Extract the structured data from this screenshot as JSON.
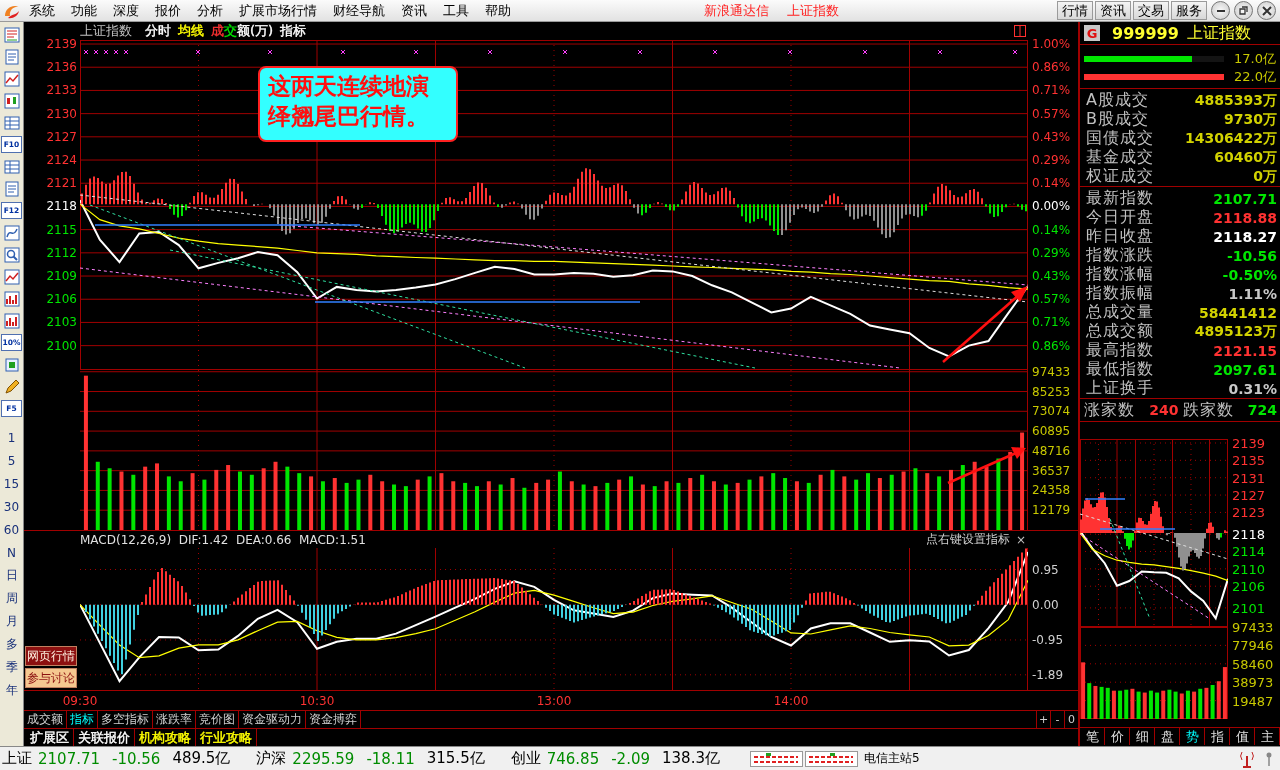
{
  "menu": {
    "items": [
      "系统",
      "功能",
      "深度",
      "报价",
      "分析",
      "扩展市场行情",
      "财经导航",
      "资讯",
      "工具",
      "帮助"
    ],
    "titles": [
      "新浪通达信",
      "上证指数"
    ],
    "buttons": [
      "行情",
      "资讯",
      "交易",
      "服务"
    ]
  },
  "toolbar": [
    {
      "kind": "icon"
    },
    {
      "kind": "icon"
    },
    {
      "kind": "icon"
    },
    {
      "kind": "icon"
    },
    {
      "kind": "icon"
    },
    {
      "kind": "text",
      "label": "F10"
    },
    {
      "kind": "icon"
    },
    {
      "kind": "icon"
    },
    {
      "kind": "text",
      "label": "F12"
    },
    {
      "kind": "icon"
    },
    {
      "kind": "icon"
    },
    {
      "kind": "icon"
    },
    {
      "kind": "icon"
    },
    {
      "kind": "icon"
    },
    {
      "kind": "text",
      "label": "10%"
    },
    {
      "kind": "icon"
    },
    {
      "kind": "icon"
    },
    {
      "kind": "text",
      "label": "F5"
    }
  ],
  "periods": [
    "1",
    "5",
    "15",
    "30",
    "60",
    "N",
    "日",
    "周",
    "月",
    "多",
    "季",
    "年"
  ],
  "side_links": [
    {
      "label": "网页行情",
      "color": "#8c1010"
    },
    {
      "label": "参与讨论",
      "color": "#f5c890"
    }
  ],
  "chart_header": {
    "title": "上证指数",
    "items": [
      {
        "segments": [
          {
            "text": "分时",
            "color": "#ffffff"
          }
        ]
      },
      {
        "segments": [
          {
            "text": "均线",
            "color": "#ffff00"
          }
        ]
      },
      {
        "segments": [
          {
            "text": "成",
            "color": "#ff3232"
          },
          {
            "text": "交",
            "color": "#00e600"
          },
          {
            "text": "额(万)",
            "color": "#ffffff"
          }
        ]
      },
      {
        "segments": [
          {
            "text": "指标",
            "color": "#ffffff"
          }
        ]
      }
    ]
  },
  "callout": "这两天连续地演绎翘尾巴行情。",
  "price_chart": {
    "right_ticks": [
      "1.00%",
      "0.86%",
      "0.71%",
      "0.57%",
      "0.43%",
      "0.29%",
      "0.14%",
      "0.00%",
      "0.14%",
      "0.29%",
      "0.43%",
      "0.57%",
      "0.71%",
      "0.86%"
    ],
    "chart_data": {
      "type": "line",
      "grid": true,
      "ylim": [
        2096.85,
        2139.52
      ],
      "categories": [
        null,
        null,
        null,
        null,
        null,
        null,
        null,
        null,
        null,
        null,
        null,
        null,
        null,
        null,
        null,
        null,
        null,
        null,
        null,
        null,
        null,
        null,
        null,
        null,
        null,
        null,
        null,
        null,
        null,
        null,
        null,
        null,
        null,
        null,
        null,
        null,
        null,
        null,
        null,
        null,
        null,
        null,
        null,
        null,
        null,
        null,
        null,
        null,
        null
      ],
      "series": [
        {
          "color": "#ffffff",
          "values": [
            2118.8,
            2113.7,
            2110.8,
            2114.5,
            2114.7,
            2113.0,
            2110.0,
            2110.7,
            2111.3,
            2112.1,
            2111.7,
            2109.5,
            2106.1,
            2107.6,
            2107.2,
            2107.0,
            2107.2,
            2107.5,
            2107.9,
            2108.6,
            2109.4,
            2110.2,
            2109.9,
            2109.2,
            2109.2,
            2109.4,
            2109.3,
            2108.9,
            2109.1,
            2109.7,
            2109.6,
            2109.0,
            2107.8,
            2106.9,
            2105.6,
            2104.3,
            2104.8,
            2106.3,
            2105.2,
            2104.1,
            2102.6,
            2102.1,
            2101.6,
            2099.7,
            2098.6,
            2100.0,
            2100.6,
            2104.2,
            2107.7
          ]
        },
        {
          "color": "#ffff00",
          "values": [
            2118.3,
            2116.3,
            2115.5,
            2115.1,
            2114.5,
            2113.9,
            2113.5,
            2113.2,
            2113.0,
            2112.8,
            2112.6,
            2112.3,
            2112.0,
            2111.9,
            2111.8,
            2111.6,
            2111.5,
            2111.4,
            2111.3,
            2111.2,
            2111.1,
            2111.0,
            2111.0,
            2110.9,
            2110.9,
            2110.8,
            2110.7,
            2110.6,
            2110.5,
            2110.4,
            2110.3,
            2110.2,
            2110.1,
            2110.0,
            2109.9,
            2109.8,
            2109.6,
            2109.5,
            2109.3,
            2109.2,
            2109.0,
            2108.8,
            2108.6,
            2108.4,
            2108.3,
            2108.0,
            2107.8,
            2107.5,
            2107.3
          ]
        }
      ],
      "yticks": [
        {
          "value": 2139,
          "label": "2139"
        },
        {
          "value": 2136,
          "label": "2136"
        },
        {
          "value": 2133,
          "label": "2133"
        },
        {
          "value": 2130,
          "label": "2130"
        },
        {
          "value": 2127,
          "label": "2127"
        },
        {
          "value": 2124,
          "label": "2124"
        },
        {
          "value": 2121,
          "label": "2121"
        },
        {
          "value": 2118,
          "label": "2118"
        },
        {
          "value": 2115,
          "label": "2115"
        },
        {
          "value": 2112,
          "label": "2112"
        },
        {
          "value": 2109,
          "label": "2109"
        },
        {
          "value": 2106,
          "label": "2106"
        },
        {
          "value": 2103,
          "label": "2103"
        },
        {
          "value": 2100,
          "label": "2100"
        }
      ]
    }
  },
  "volume_chart": {
    "chart_data": {
      "type": "bar",
      "stacked": true,
      "grid": true,
      "ylim": [
        0,
        98500
      ],
      "series": [
        {
          "color": "#ff3232",
          "values": [
            95000,
            null,
            null,
            36000,
            null,
            39000,
            41000,
            null,
            null,
            35000,
            null,
            37000,
            40000,
            null,
            null,
            38000,
            42000,
            null,
            null,
            33000,
            null,
            32000,
            null,
            null,
            34000,
            30000,
            null,
            null,
            31000,
            null,
            35000,
            30000,
            null,
            null,
            30000,
            null,
            32000,
            null,
            29000,
            31000,
            null,
            30000,
            null,
            27000,
            null,
            31000,
            null,
            28000,
            null,
            30000,
            null,
            32000,
            null,
            30000,
            null,
            29000,
            null,
            33000,
            null,
            null,
            30000,
            null,
            34000,
            null,
            33000,
            null,
            null,
            32000,
            null,
            36000,
            null,
            35000,
            null,
            37000,
            null,
            42000,
            39000,
            null,
            48000,
            60000
          ]
        },
        {
          "color": "#00e600",
          "values": [
            null,
            42000,
            38000,
            null,
            34000,
            null,
            null,
            33000,
            30000,
            null,
            31000,
            null,
            null,
            36000,
            34000,
            null,
            null,
            39000,
            35000,
            null,
            30000,
            null,
            29000,
            31000,
            null,
            null,
            28000,
            27000,
            null,
            33000,
            null,
            null,
            29000,
            27000,
            null,
            28000,
            null,
            26000,
            null,
            null,
            36000,
            null,
            28000,
            null,
            29000,
            null,
            33000,
            null,
            27000,
            null,
            29000,
            null,
            34000,
            null,
            28000,
            null,
            31000,
            null,
            35000,
            32000,
            null,
            29000,
            null,
            37000,
            null,
            31000,
            35000,
            null,
            34000,
            null,
            38000,
            null,
            33000,
            null,
            40000,
            null,
            null,
            44000,
            null,
            null
          ]
        }
      ],
      "yticks": [
        {
          "value": 97433,
          "label": "97433"
        },
        {
          "value": 85253,
          "label": "85253"
        },
        {
          "value": 73074,
          "label": "73074"
        },
        {
          "value": 60895,
          "label": "60895"
        },
        {
          "value": 48716,
          "label": "48716"
        },
        {
          "value": 36537,
          "label": "36537"
        },
        {
          "value": 24358,
          "label": "24358"
        },
        {
          "value": 12179,
          "label": "12179"
        }
      ]
    }
  },
  "macd_chart": {
    "legend": "MACD(12,26,9)  DIF:1.42  DEA:0.66  MACD:1.51",
    "hint": "点右键设置指标",
    "close": "×",
    "chart_data": {
      "type": "line",
      "grid": true,
      "ylim": [
        -2.3,
        1.53
      ],
      "categories": [
        "09:30",
        null,
        null,
        null,
        null,
        null,
        null,
        null,
        null,
        null,
        null,
        null,
        "10:30",
        null,
        null,
        null,
        null,
        null,
        null,
        null,
        null,
        null,
        null,
        null,
        "13:00",
        null,
        null,
        null,
        null,
        null,
        null,
        null,
        null,
        null,
        null,
        null,
        "14:00",
        null,
        null,
        null,
        null,
        null,
        null,
        null,
        null,
        null,
        null,
        null,
        null
      ],
      "series": [
        {
          "color": "#ffffff",
          "values": [
            0,
            -1.03,
            -2.06,
            -1.42,
            -0.87,
            -0.88,
            -1.23,
            -1.21,
            -0.84,
            -0.38,
            -0.14,
            -0.47,
            -1.19,
            -1.0,
            -0.92,
            -0.92,
            -0.78,
            -0.55,
            -0.32,
            -0.08,
            0.16,
            0.43,
            0.63,
            0.48,
            0.13,
            -0.15,
            -0.24,
            -0.33,
            -0.16,
            0.18,
            0.3,
            0.27,
            0.25,
            -0.08,
            -0.47,
            -0.87,
            -1.1,
            -0.64,
            -0.5,
            -0.5,
            -0.75,
            -1.0,
            -0.96,
            -0.99,
            -1.37,
            -1.22,
            -0.63,
            0.08,
            1.42
          ]
        },
        {
          "color": "#ffff00",
          "values": [
            0,
            -0.55,
            -1.09,
            -1.43,
            -1.38,
            -1.17,
            -1.08,
            -1.08,
            -0.95,
            -0.7,
            -0.47,
            -0.45,
            -0.7,
            -0.88,
            -0.95,
            -0.95,
            -0.89,
            -0.78,
            -0.65,
            -0.42,
            -0.19,
            0.07,
            0.31,
            0.39,
            0.26,
            0.09,
            -0.08,
            -0.24,
            -0.2,
            -0.02,
            0.09,
            0.16,
            0.24,
            0.06,
            -0.12,
            -0.44,
            -0.76,
            -0.79,
            -0.68,
            -0.57,
            -0.64,
            -0.75,
            -0.81,
            -0.87,
            -1.11,
            -1.09,
            -0.83,
            -0.4,
            0.66
          ]
        }
      ],
      "yticks": [
        {
          "value": 0.95,
          "label": "0.95"
        },
        {
          "value": 0,
          "label": "0.00"
        },
        {
          "value": -0.95,
          "label": "-0.95"
        },
        {
          "value": -1.89,
          "label": "-1.89"
        }
      ]
    }
  },
  "bottom_tabs": [
    {
      "label": "成交额",
      "selected": false
    },
    {
      "label": "指标",
      "selected": true
    },
    {
      "label": "多空指标",
      "selected": false
    },
    {
      "label": "涨跌率",
      "selected": false
    },
    {
      "label": "竞价图",
      "selected": false
    },
    {
      "label": "资金驱动力",
      "selected": false
    },
    {
      "label": "资金搏弈",
      "selected": false
    }
  ],
  "zoom_buttons": [
    "+",
    "-",
    "0"
  ],
  "sub_tabs": [
    {
      "label": "扩展区",
      "color": "#ffffff"
    },
    {
      "label": "关联报价",
      "color": "#ffffff"
    },
    {
      "label": "机构攻略",
      "color": "#ffff00"
    },
    {
      "label": "行业攻略",
      "color": "#ffff00"
    }
  ],
  "quote_panel": {
    "badge": "G",
    "code": "999999",
    "name": "上证指数",
    "meters": [
      {
        "label": "17.0亿",
        "level": 0.77,
        "color": "#00e600"
      },
      {
        "label": "22.0亿",
        "level": 1.0,
        "color": "#ff3232"
      }
    ],
    "turnover": [
      {
        "label": "A股成交",
        "value": "4885393万"
      },
      {
        "label": "B股成交",
        "value": "9730万"
      },
      {
        "label": "国债成交",
        "value": "14306422万"
      },
      {
        "label": "基金成交",
        "value": "60460万"
      },
      {
        "label": "权证成交",
        "value": "0万"
      }
    ],
    "stats": [
      {
        "label": "最新指数",
        "value": "2107.71",
        "color": "#00e600"
      },
      {
        "label": "今日开盘",
        "value": "2118.88",
        "color": "#ff3232"
      },
      {
        "label": "昨日收盘",
        "value": "2118.27",
        "color": "#ffffff"
      },
      {
        "label": "指数涨跌",
        "value": "-10.56",
        "color": "#00e600"
      },
      {
        "label": "指数涨幅",
        "value": "-0.50%",
        "color": "#00e600"
      },
      {
        "label": "指数振幅",
        "value": "1.11%",
        "color": "#c8c8c8"
      },
      {
        "label": "总成交量",
        "value": "58441412",
        "color": "#d2d200"
      },
      {
        "label": "总成交额",
        "value": "4895123万",
        "color": "#d2d200"
      },
      {
        "label": "最高指数",
        "value": "2121.15",
        "color": "#ff3232"
      },
      {
        "label": "最低指数",
        "value": "2097.61",
        "color": "#00e600"
      },
      {
        "label": "上证换手",
        "value": "0.31%",
        "color": "#c8c8c8"
      }
    ],
    "breadth": {
      "up_label": "涨家数",
      "up_count": "240",
      "down_label": "跌家数",
      "down_count": "724"
    }
  },
  "mini_chart": {
    "price": {
      "chart_data": {
        "type": "line",
        "grid": true,
        "ylim": [
          2096.6,
          2139.92
        ],
        "categories": [
          null,
          null,
          null,
          null,
          null,
          null,
          null,
          null,
          null,
          null,
          null,
          null,
          null
        ],
        "series": [
          {
            "color": "#ffffff",
            "values": [
              2118.8,
              2114.7,
              2111.3,
              2106.1,
              2107.2,
              2109.4,
              2109.2,
              2109.1,
              2107.8,
              2104.8,
              2102.6,
              2098.6,
              2107.7
            ]
          },
          {
            "color": "#ffff00",
            "values": [
              2118.3,
              2114.5,
              2113.0,
              2112.0,
              2111.5,
              2111.1,
              2110.9,
              2110.5,
              2110.1,
              2109.6,
              2109.0,
              2108.3,
              2107.3
            ]
          }
        ],
        "yticks": [
          {
            "value": 2139,
            "label": "2139"
          },
          {
            "value": 2135,
            "label": "2135"
          },
          {
            "value": 2131,
            "label": "2131"
          },
          {
            "value": 2127,
            "label": "2127"
          },
          {
            "value": 2123,
            "label": "2123"
          },
          {
            "value": 2118,
            "label": "2118"
          },
          {
            "value": 2114,
            "label": "2114"
          },
          {
            "value": 2110,
            "label": "2110"
          },
          {
            "value": 2106,
            "label": "2106"
          },
          {
            "value": 2101,
            "label": "2101"
          }
        ]
      }
    },
    "volume": {
      "chart_data": {
        "type": "bar",
        "stacked": true,
        "grid": true,
        "ylim": [
          0,
          97433
        ],
        "series": [
          {
            "color": "#ff3232",
            "values": [
              60000,
              null,
              35000,
              null,
              null,
              30000,
              null,
              null,
              32000,
              null,
              28000,
              null,
              null,
              30000,
              null,
              null,
              27000,
              null,
              29000,
              null,
              33000,
              null,
              40000,
              55000
            ]
          },
          {
            "color": "#00e600",
            "values": [
              null,
              38000,
              null,
              34000,
              33000,
              null,
              30000,
              31000,
              null,
              29000,
              null,
              30000,
              28000,
              null,
              31000,
              29000,
              null,
              30000,
              null,
              32000,
              null,
              36000,
              null,
              null
            ]
          }
        ],
        "yticks": [
          {
            "value": 97433,
            "label": "97433"
          },
          {
            "value": 77946,
            "label": "77946"
          },
          {
            "value": 58460,
            "label": "58460"
          },
          {
            "value": 38973,
            "label": "38973"
          },
          {
            "value": 19487,
            "label": "19487"
          }
        ]
      }
    }
  },
  "mini_tabs": [
    {
      "label": "笔",
      "selected": false
    },
    {
      "label": "价",
      "selected": false
    },
    {
      "label": "细",
      "selected": false
    },
    {
      "label": "盘",
      "selected": false
    },
    {
      "label": "势",
      "selected": true
    },
    {
      "label": "指",
      "selected": false
    },
    {
      "label": "值",
      "selected": false
    },
    {
      "label": "主",
      "selected": false
    }
  ],
  "status_bar": {
    "markets": [
      {
        "name": "上证",
        "price": "2107.71",
        "change": "-10.56",
        "amount": "489.5亿",
        "color": "#008c00"
      },
      {
        "name": "沪深",
        "price": "2295.59",
        "change": "-18.11",
        "amount": "315.5亿",
        "color": "#008c00"
      },
      {
        "name": "创业",
        "price": "746.85",
        "change": "-2.09",
        "amount": "138.3亿",
        "color": "#008c00"
      }
    ],
    "server": "电信主站5"
  }
}
